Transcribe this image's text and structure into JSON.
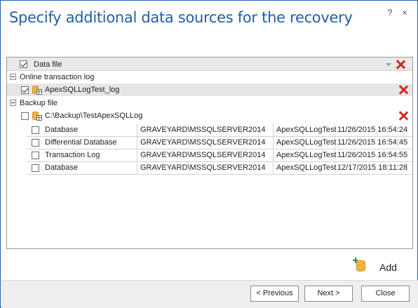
{
  "dialog": {
    "title": "Specify additional data sources for the recovery",
    "help_label": "?",
    "close_label": "×"
  },
  "grid": {
    "header": {
      "label": "Data file",
      "checked": true
    },
    "groups": [
      {
        "label": "Online transaction log",
        "rows": [
          {
            "label": "ApexSQLLogTest_log",
            "checked": true
          }
        ]
      },
      {
        "label": "Backup file",
        "parent": {
          "label": "C:\\Backup\\TestApexSQLLog",
          "checked": false
        },
        "rows": [
          {
            "type": "Database",
            "server": "GRAVEYARD\\MSSQLSERVER2014",
            "db": "ApexSQLLogTest",
            "date": "11/26/2015 16:54:24",
            "checked": false
          },
          {
            "type": "Differential Database",
            "server": "GRAVEYARD\\MSSQLSERVER2014",
            "db": "ApexSQLLogTest",
            "date": "11/26/2015 16:54:45",
            "checked": false
          },
          {
            "type": "Transaction Log",
            "server": "GRAVEYARD\\MSSQLSERVER2014",
            "db": "ApexSQLLogTest",
            "date": "11/26/2015 16:54:55",
            "checked": false
          },
          {
            "type": "Database",
            "server": "GRAVEYARD\\MSSQLSERVER2014",
            "db": "ApexSQLLogTest",
            "date": "12/17/2015 18:11:28",
            "checked": false
          }
        ]
      }
    ]
  },
  "add": {
    "label": "Add",
    "icon": "add-database-icon"
  },
  "footer": {
    "previous_label": "< Previous",
    "next_label": "Next >",
    "close_label": "Close"
  },
  "colors": {
    "title": "#1f5fa6",
    "remove": "#d8281e",
    "accent": "#f1b43c"
  }
}
